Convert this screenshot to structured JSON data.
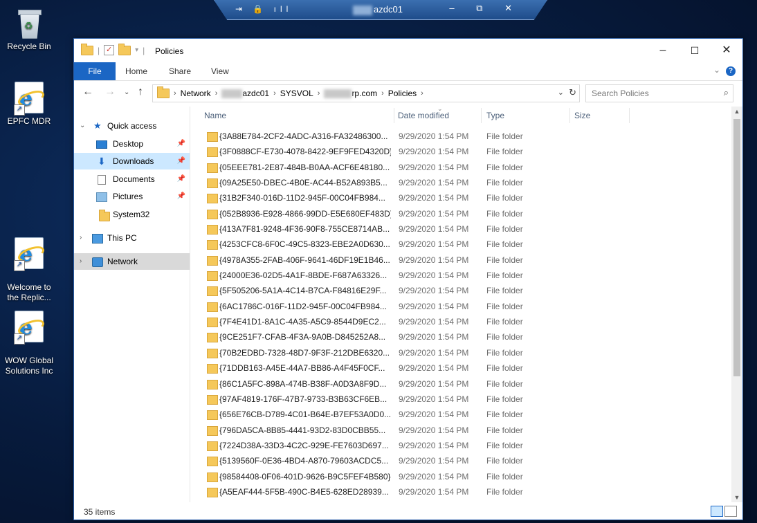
{
  "desktop": {
    "icons": [
      {
        "label": "Recycle Bin"
      },
      {
        "label": "EPFC MDR"
      },
      {
        "label": "Welcome to\nthe Replic..."
      },
      {
        "label": "WOW Global\nSolutions Inc"
      }
    ]
  },
  "rdp_bar": {
    "host": "azdc01",
    "icons_left": "⇥ 🔒 ıll",
    "icons_right": "– ⧉ ✕"
  },
  "window": {
    "title": "Policies",
    "controls": {
      "minimize": "–",
      "maximize": "☐",
      "close": "✕"
    },
    "ribbon_tabs": [
      "File",
      "Home",
      "Share",
      "View"
    ],
    "help": "?",
    "address": {
      "crumbs": [
        "Network",
        "azdc01",
        "SYSVOL",
        "rp.com",
        "Policies"
      ],
      "separator": "›"
    },
    "search": {
      "placeholder": "Search Policies"
    },
    "nav": {
      "quick_access": "Quick access",
      "items": [
        "Desktop",
        "Downloads",
        "Documents",
        "Pictures",
        "System32"
      ],
      "this_pc": "This PC",
      "network": "Network"
    },
    "columns": {
      "name": "Name",
      "date": "Date modified",
      "type": "Type",
      "size": "Size"
    },
    "files": [
      {
        "name": "{3A88E784-2CF2-4ADC-A316-FA32486300...",
        "date": "9/29/2020 1:54 PM",
        "type": "File folder"
      },
      {
        "name": "{3F0888CF-E730-4078-8422-9EF9FED4320D}",
        "date": "9/29/2020 1:54 PM",
        "type": "File folder"
      },
      {
        "name": "{05EEE781-2E87-484B-B0AA-ACF6E48180...",
        "date": "9/29/2020 1:54 PM",
        "type": "File folder"
      },
      {
        "name": "{09A25E50-DBEC-4B0E-AC44-B52A893B5...",
        "date": "9/29/2020 1:54 PM",
        "type": "File folder"
      },
      {
        "name": "{31B2F340-016D-11D2-945F-00C04FB984...",
        "date": "9/29/2020 1:54 PM",
        "type": "File folder"
      },
      {
        "name": "{052B8936-E928-4866-99DD-E5E680EF483D}",
        "date": "9/29/2020 1:54 PM",
        "type": "File folder"
      },
      {
        "name": "{413A7F81-9248-4F36-90F8-755CE8714AB...",
        "date": "9/29/2020 1:54 PM",
        "type": "File folder"
      },
      {
        "name": "{4253CFC8-6F0C-49C5-8323-EBE2A0D630...",
        "date": "9/29/2020 1:54 PM",
        "type": "File folder"
      },
      {
        "name": "{4978A355-2FAB-406F-9641-46DF19E1B46...",
        "date": "9/29/2020 1:54 PM",
        "type": "File folder"
      },
      {
        "name": "{24000E36-02D5-4A1F-8BDE-F687A63326...",
        "date": "9/29/2020 1:54 PM",
        "type": "File folder"
      },
      {
        "name": "{5F505206-5A1A-4C14-B7CA-F84816E29F...",
        "date": "9/29/2020 1:54 PM",
        "type": "File folder"
      },
      {
        "name": "{6AC1786C-016F-11D2-945F-00C04FB984...",
        "date": "9/29/2020 1:54 PM",
        "type": "File folder"
      },
      {
        "name": "{7F4E41D1-8A1C-4A35-A5C9-8544D9EC2...",
        "date": "9/29/2020 1:54 PM",
        "type": "File folder"
      },
      {
        "name": "{9CE251F7-CFAB-4F3A-9A0B-D845252A8...",
        "date": "9/29/2020 1:54 PM",
        "type": "File folder"
      },
      {
        "name": "{70B2EDBD-7328-48D7-9F3F-212DBE6320...",
        "date": "9/29/2020 1:54 PM",
        "type": "File folder"
      },
      {
        "name": "{71DDB163-A45E-44A7-BB86-A4F45F0CF...",
        "date": "9/29/2020 1:54 PM",
        "type": "File folder"
      },
      {
        "name": "{86C1A5FC-898A-474B-B38F-A0D3A8F9D...",
        "date": "9/29/2020 1:54 PM",
        "type": "File folder"
      },
      {
        "name": "{97AF4819-176F-47B7-9733-B3B63CF6EB...",
        "date": "9/29/2020 1:54 PM",
        "type": "File folder"
      },
      {
        "name": "{656E76CB-D789-4C01-B64E-B7EF53A0D0...",
        "date": "9/29/2020 1:54 PM",
        "type": "File folder"
      },
      {
        "name": "{796DA5CA-8B85-4441-93D2-83D0CBB55...",
        "date": "9/29/2020 1:54 PM",
        "type": "File folder"
      },
      {
        "name": "{7224D38A-33D3-4C2C-929E-FE7603D697...",
        "date": "9/29/2020 1:54 PM",
        "type": "File folder"
      },
      {
        "name": "{5139560F-0E36-4BD4-A870-79603ACDC5...",
        "date": "9/29/2020 1:54 PM",
        "type": "File folder"
      },
      {
        "name": "{98584408-0F06-401D-9626-B9C5FEF4B580}",
        "date": "9/29/2020 1:54 PM",
        "type": "File folder"
      },
      {
        "name": "{A5EAF444-5F5B-490C-B4E5-628ED28939...",
        "date": "9/29/2020 1:54 PM",
        "type": "File folder"
      }
    ],
    "status": {
      "count": "35 items"
    }
  },
  "colors": {
    "accent": "#1b66c4",
    "selected": "#cce8ff",
    "folder": "#f5c85a"
  }
}
